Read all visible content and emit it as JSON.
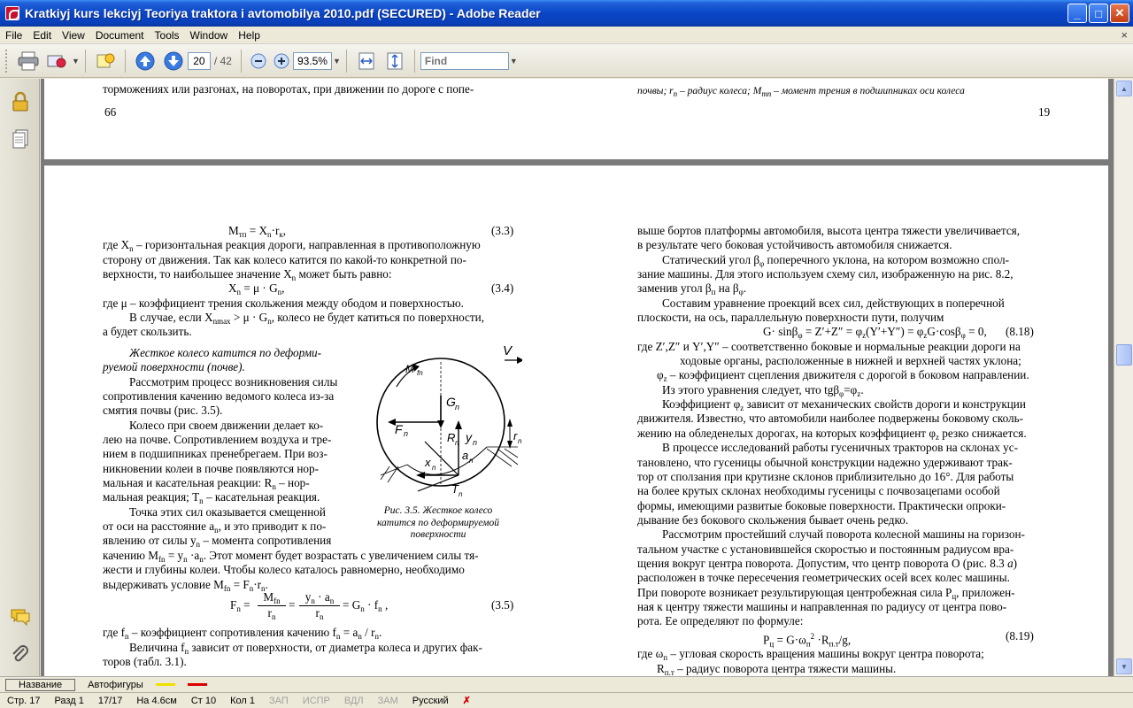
{
  "window": {
    "title": "Kratkiyj kurs lekciyj Teoriya traktora i avtomobilya 2010.pdf (SECURED) - Adobe Reader",
    "minimize": "_",
    "maximize": "□",
    "close": "✕"
  },
  "menu": {
    "items": [
      "File",
      "Edit",
      "View",
      "Document",
      "Tools",
      "Window",
      "Help"
    ],
    "close": "×"
  },
  "toolbar": {
    "page_current": "20",
    "page_total": "/ 42",
    "zoom": "93.5%",
    "find_placeholder": "Find"
  },
  "page_top": {
    "left_lines": [
      "торможениях или разгонах, на поворотах, при движении по дороге с попе-"
    ],
    "left_page_no": "66",
    "right_line": "почвы; r",
    "right_line_rest": " – радиус колеса; M",
    "right_line_end": " – момент трения в подшипниках оси колеса",
    "right_page_no": "19"
  },
  "page_left": {
    "eq33": "M",
    "eq33_num": "(3.3)",
    "p1": "где X",
    "p1_rest": " – горизонтальная реакция дороги, направленная в противоположную",
    "p2": "сторону от движения. Так как колесо катится по какой-то конкретной по-",
    "p3": "верхности, то наибольшее значение X",
    "p3_rest": " может быть равно:",
    "eq34": "X",
    "eq34_num": "(3.4)",
    "p4": "где μ – коэффициент трения скольжения между ободом и поверхностью.",
    "p5": "В случае, если X",
    "p5_rest": " > μ · G",
    "p5_end": ", колесо не будет катиться по поверхности,",
    "p6": "а будет скользить.",
    "h1": "Жесткое колесо катится по деформи-",
    "h2": "руемой поверхности (почве).",
    "w1": "Рассмотрим процесс возникновения силы",
    "w2": "сопротивления качению ведомого колеса из-за",
    "w3": "смятия почвы (рис. 3.5).",
    "w4": "Колесо при своем движении делает ко-",
    "w5": "лею на почве. Сопротивлением воздуха и тре-",
    "w6": "нием в подшипниках пренебрегаем. При воз-",
    "w7": "никновении колеи в почве появляются нор-",
    "w8": "мальная и касательная реакции: R",
    "w8_rest": " – нор-",
    "w9": "мальная реакция; T",
    "w9_rest": " – касательная реакция.",
    "w10": "Точка этих сил оказывается смещенной",
    "w11": "от оси на расстояние a",
    "w11_rest": ", и это приводит к по-",
    "w12": "явлению от силы y",
    "w12_rest": " – момента сопротивления",
    "w13": "качению M",
    "w13_rest": " = y",
    "w13_end": " ·a",
    "w13_tail": ". Этот момент будет возрастать с увеличением силы тя-",
    "w14": "жести и глубины колеи. Чтобы колесо каталось равномерно, необходимо",
    "w15": "выдерживать условие  M",
    "w15_rest": " = F",
    "w15_end": "·r",
    "eq35_num": "(3.5)",
    "p7": "где f",
    "p7_rest": " – коэффициент сопротивления качению f",
    "p7_end": " = a",
    "p7_tail": " / r",
    "p8": "Величина f",
    "p8_rest": " зависит от поверхности, от диаметра колеса и других фак-",
    "p9": "торов (табл. 3.1).",
    "caption1": "Рис. 3.5. Жесткое колесо",
    "caption2": "катится по деформируемой",
    "caption3": "поверхности"
  },
  "page_right": {
    "r1": "выше бортов платформы автомобиля, высота центра тяжести увеличивается,",
    "r2": "в результате чего боковая устойчивость автомобиля снижается.",
    "r3": "Статический угол β",
    "r3_rest": " поперечного уклона, на котором возможно спол-",
    "r4": "зание машины. Для этого используем схему сил, изображенную на рис. 8.2,",
    "r5": "заменив угол β",
    "r5_rest": " на β",
    "r6": "Составим уравнение проекций всех сил, действующих в поперечной",
    "r7": "плоскости, на ось, параллельную поверхности пути, получим",
    "eq818": "G· sinβ",
    "eq818_rest": " = Z′+Z″ = φ",
    "eq818_end": "(Y′+Y″) = φ",
    "eq818_tail": "G·cosβ",
    "eq818_fin": " = 0,",
    "eq818_num": "(8.18)",
    "r8": "где Z′,Z″ и Y′,Y″ – соответственно боковые и нормальные реакции дороги на",
    "r9": "ходовые органы, расположенные в нижней и верхней частях уклона;",
    "r10": "φ",
    "r10_rest": " – коэффициент сцепления движителя с дорогой в боковом направлении.",
    "r11": "Из этого уравнения следует, что tgβ",
    "r11_rest": "=φ",
    "r12": "Коэффициент φ",
    "r12_rest": " зависит от механических свойств дороги и конструкции",
    "r13": "движителя. Известно, что автомобили наиболее подвержены боковому сколь-",
    "r14": "жению на обледенелых дорогах, на которых коэффициент φ",
    "r14_rest": " резко снижается.",
    "r15": "В процессе исследований работы гусеничных тракторов на склонах ус-",
    "r16": "тановлено, что гусеницы обычной конструкции надежно удерживают трак-",
    "r17": "тор от сползания при крутизне склонов приблизительно до 16°. Для работы",
    "r18": "на более крутых склонах необходимы гусеницы с почвозацепами особой",
    "r19": "формы, имеющими развитые боковые поверхности. Практически опроки-",
    "r20": "дывание без бокового скольжения бывает очень редко.",
    "r21": "Рассмотрим простейший случай поворота колесной машины на горизон-",
    "r22": "тальном участке с установившейся скоростью и постоянным радиусом вра-",
    "r23": "щения вокруг центра поворота. Допустим, что центр поворота O (рис. 8.3 ",
    "r23_it": "а",
    "r23_end": ")",
    "r24": "расположен в точке пересечения геометрических осей всех колес машины.",
    "r25": "При повороте возникает результирующая центробежная сила P",
    "r25_rest": ", приложен-",
    "r26": "ная к центру тяжести машины и направленная по радиусу от центра пово-",
    "r27": "рота. Ее определяют по формуле:",
    "eq819": "P",
    "eq819_rest": " = G·ω",
    "eq819_end": " ·R",
    "eq819_tail": "/g,",
    "eq819_num": "(8.19)",
    "r28": "где ω",
    "r28_rest": " – угловая скорость вращения машины вокруг центра поворота;",
    "r29": "R",
    "r29_rest": " – радиус поворота центра тяжести машины."
  },
  "wordstrip": {
    "style": "Название",
    "font": "Автофигуры"
  },
  "statusbar": {
    "page": "Стр.  17",
    "section": "Разд  1",
    "count": "17/17",
    "at": "На  4.6см",
    "line": "Ст  10",
    "col": "Кол  1",
    "rec": "ЗАП",
    "trk": "ИСПР",
    "ext": "ВДЛ",
    "ovr": "ЗАМ",
    "lang": "Русский"
  },
  "colors": {
    "titlebar": "#0a46c8",
    "doc_bg": "#7a7a7a"
  }
}
